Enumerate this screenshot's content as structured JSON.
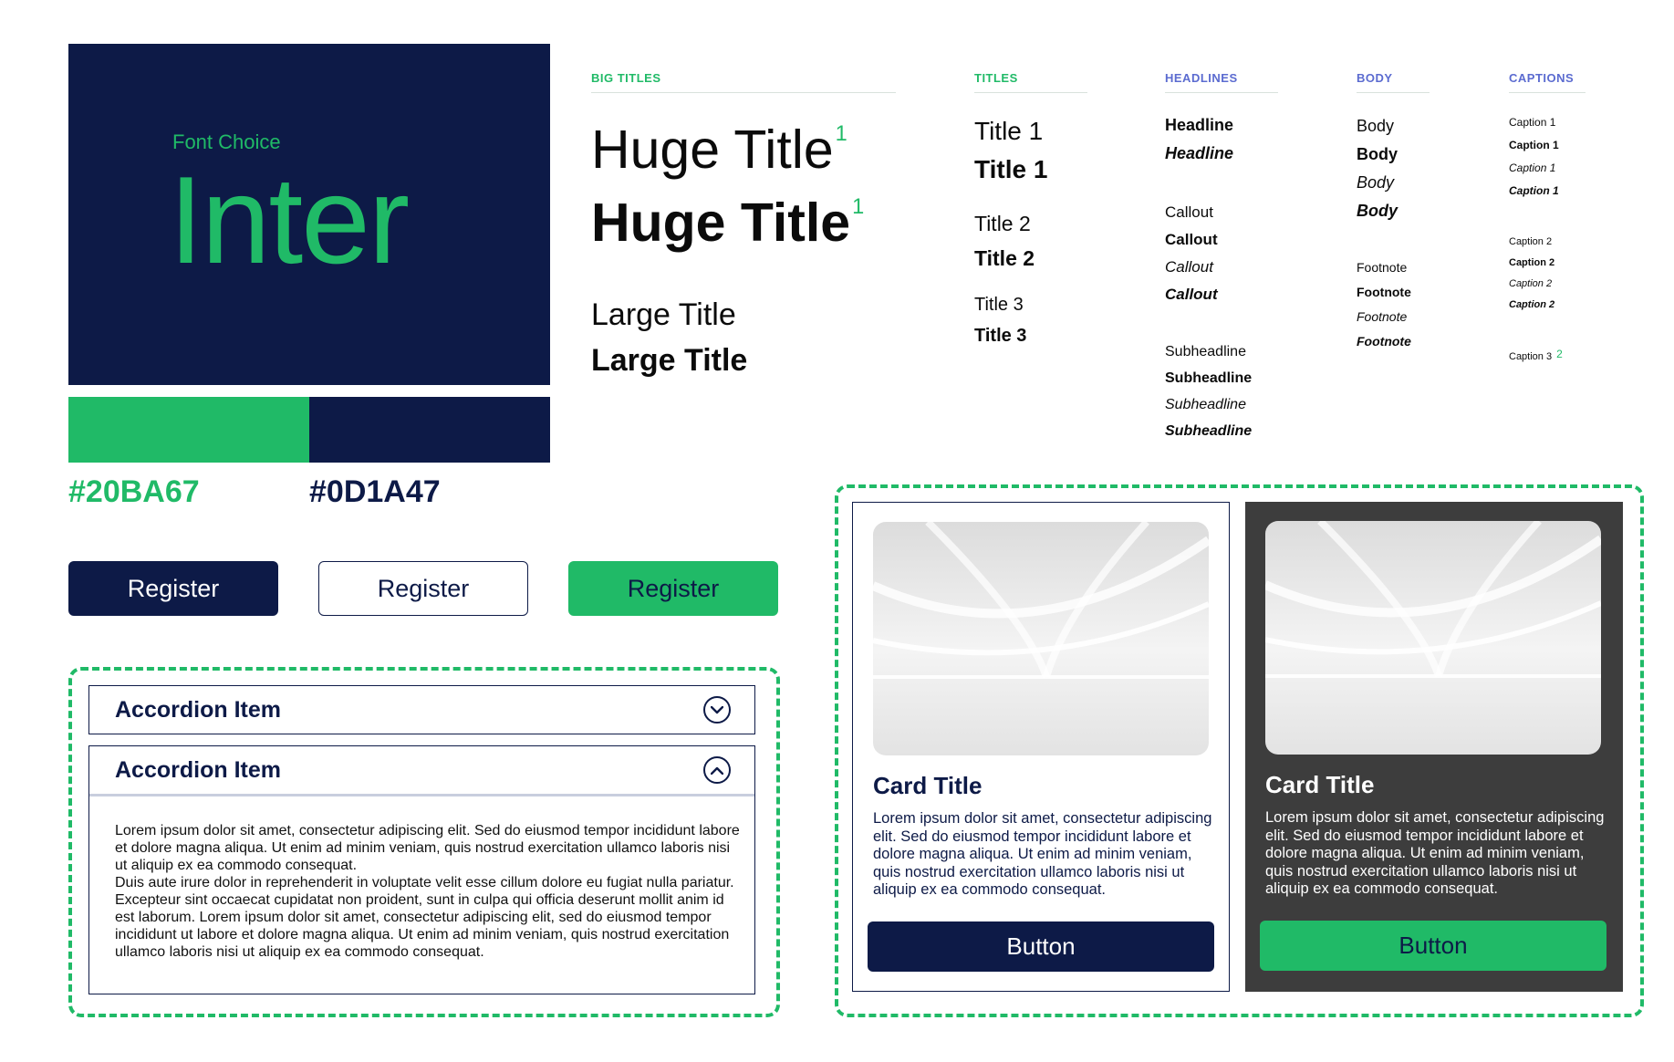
{
  "hero": {
    "label": "Font Choice",
    "font_name": "Inter"
  },
  "palette": [
    {
      "hex": "#20BA67",
      "label": "#20BA67"
    },
    {
      "hex": "#0D1A47",
      "label": "#0D1A47"
    }
  ],
  "colors": {
    "green": "#20BA67",
    "navy": "#0D1A47",
    "dark_card": "#3d3d3d",
    "headlines_head": "#5b6bd0"
  },
  "typography": {
    "big_titles": {
      "heading": "BIG TITLES",
      "huge_regular": "Huge Title",
      "huge_bold": "Huge Title",
      "huge_note": "1",
      "large_regular": "Large Title",
      "large_bold": "Large Title"
    },
    "titles": {
      "heading": "TITLES",
      "t1_regular": "Title 1",
      "t1_bold": "Title 1",
      "t2_regular": "Title 2",
      "t2_bold": "Title 2",
      "t3_regular": "Title 3",
      "t3_bold": "Title 3"
    },
    "headlines": {
      "heading": "HEADLINES",
      "headline_bold": "Headline",
      "headline_bold_italic": "Headline",
      "callout_regular": "Callout",
      "callout_bold": "Callout",
      "callout_italic": "Callout",
      "callout_bold_italic": "Callout",
      "sub_regular": "Subheadline",
      "sub_bold": "Subheadline",
      "sub_italic": "Subheadline",
      "sub_bold_italic": "Subheadline"
    },
    "body": {
      "heading": "BODY",
      "body_regular": "Body",
      "body_bold": "Body",
      "body_italic": "Body",
      "body_bold_italic": "Body",
      "foot_regular": "Footnote",
      "foot_bold": "Footnote",
      "foot_italic": "Footnote",
      "foot_bold_italic": "Footnote"
    },
    "captions": {
      "heading": "CAPTIONS",
      "c1_regular": "Caption 1",
      "c1_bold": "Caption 1",
      "c1_italic": "Caption 1",
      "c1_bold_italic": "Caption 1",
      "c2_regular": "Caption 2",
      "c2_bold": "Caption 2",
      "c2_italic": "Caption 2",
      "c2_bold_italic": "Caption 2",
      "c3_regular": "Caption 3",
      "c3_note": "2"
    }
  },
  "buttons": {
    "primary": "Register",
    "outline": "Register",
    "success": "Register"
  },
  "accordion": {
    "items": [
      {
        "title": "Accordion Item",
        "state": "collapsed"
      },
      {
        "title": "Accordion Item",
        "state": "expanded"
      }
    ],
    "body_p1": "Lorem ipsum dolor sit amet, consectetur adipiscing elit. Sed do eiusmod tempor incididunt labore et dolore magna aliqua. Ut enim ad minim veniam, quis nostrud exercitation ullamco laboris nisi ut aliquip ex ea commodo consequat.",
    "body_p2": "Duis aute irure dolor in reprehenderit in voluptate velit esse cillum dolore eu fugiat nulla pariatur. Excepteur sint occaecat cupidatat non proident, sunt in culpa qui officia deserunt mollit anim id est laborum. Lorem ipsum dolor sit amet, consectetur adipiscing elit, sed do eiusmod tempor incididunt ut labore et dolore magna aliqua. Ut enim ad minim veniam, quis nostrud exercitation ullamco laboris nisi ut aliquip ex ea commodo consequat."
  },
  "cards": [
    {
      "theme": "light",
      "title": "Card Title",
      "text": "Lorem ipsum dolor sit amet, consectetur adipiscing elit. Sed do eiusmod tempor incididunt labore et dolore magna aliqua. Ut enim ad minim veniam, quis nostrud exercitation ullamco laboris nisi ut aliquip ex ea commodo consequat.",
      "button": "Button"
    },
    {
      "theme": "dark",
      "title": "Card Title",
      "text": "Lorem ipsum dolor sit amet, consectetur adipiscing elit. Sed do eiusmod tempor incididunt labore et dolore magna aliqua. Ut enim ad minim veniam, quis nostrud exercitation ullamco laboris nisi ut aliquip ex ea commodo consequat.",
      "button": "Button"
    }
  ],
  "icons": {
    "accordion_collapsed": "chevron-down-circle-icon",
    "accordion_expanded": "chevron-up-circle-icon"
  }
}
